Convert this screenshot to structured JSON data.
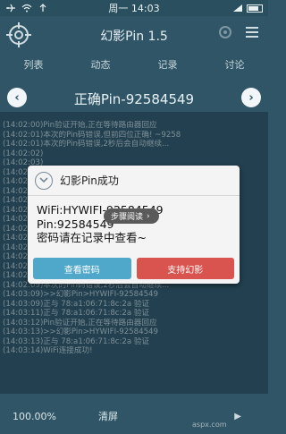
{
  "statusbar": {
    "center": "周一 14:03"
  },
  "header": {
    "app_title": "幻影Pin 1.5"
  },
  "tabs": [
    "列表",
    "动态",
    "记录",
    "讨论"
  ],
  "pin_title": "正确Pin-92584549",
  "log": [
    "(14:02:00)Pin验证开始,正在等待路由器回应",
    "(14:02:01)本次的Pin码错误,但前四位正确! ~9258",
    "(14:02:01)本次的Pin码错误,2秒后会自动继续...",
    "(14:02:02)",
    "(14:02:03)",
    "(14:02:04)",
    "(14:02:04)",
    "(14:02:05)",
    "(14:02:05)",
    "(14:02:06)",
    "(14:02:07)",
    "(14:02:07)",
    "(14:02:08)",
    "(14:02:09)",
    "(14:02:09)",
    "(14:02:09)",
    "(14:02:09)",
    "(14:02:09)本次的Pin码错误,2秒后会自动继续...",
    "(14:03:09)>>幻影Pin>HYWIFI-92584549",
    "(14:03:09)正与 78:a1:06:71:8c:2a 验证",
    "(14:03:11)正与 78:a1:06:71:8c:2a 验证",
    "(14:03:12)Pin验证开始,正在等待路由器回应",
    "(14:03:13)>>幻影Pin>HYWIFI-92584549",
    "(14:03:13)正与 78:a1:06:71:8c:2a 验证",
    "(14:03:14)WiFi连接成功!"
  ],
  "dialog": {
    "title": "幻影Pin成功",
    "wifi_line": "WiFi:HYWIFI-92584549",
    "pin_line": "Pin:92584549",
    "note_line": "密码请在记录中查看~",
    "pill": "步骤阅读",
    "btn_view": "查看密码",
    "btn_support": "支持幻影"
  },
  "bottom": {
    "progress": "100.00%",
    "clear": "清屏",
    "mark": "▶"
  },
  "watermark": "aspx.com",
  "colors": {
    "bg": "#2f5566",
    "btn_view": "#4fa7c9",
    "btn_support": "#d9534f"
  }
}
